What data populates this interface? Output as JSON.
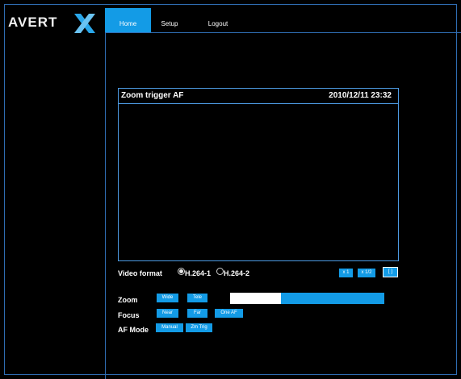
{
  "brand": {
    "logo_text": "AVERT",
    "logo_mark": "x-logo-icon"
  },
  "nav": {
    "home": "Home",
    "setup": "Setup",
    "logout": "Logout"
  },
  "video": {
    "title": "Zoom trigger AF",
    "datetime": "2010/12/11 23:32"
  },
  "video_format": {
    "label": "Video format",
    "options": [
      {
        "label": "H.264-1",
        "selected": true
      },
      {
        "label": "H.264-2",
        "selected": false
      }
    ]
  },
  "view_buttons": [
    "x 1",
    "x 1/2",
    "[ ]"
  ],
  "zoom": {
    "label": "Zoom",
    "wide": "Wide",
    "tele": "Tele",
    "position_fraction": 0.33
  },
  "focus": {
    "label": "Focus",
    "near": "Near",
    "far": "Far",
    "one_af": "One AF"
  },
  "af_mode": {
    "label": "AF Mode",
    "manual": "Manual",
    "zm_trig": "Zm Trig"
  },
  "colors": {
    "accent": "#139be6",
    "border": "#2f6db3"
  }
}
